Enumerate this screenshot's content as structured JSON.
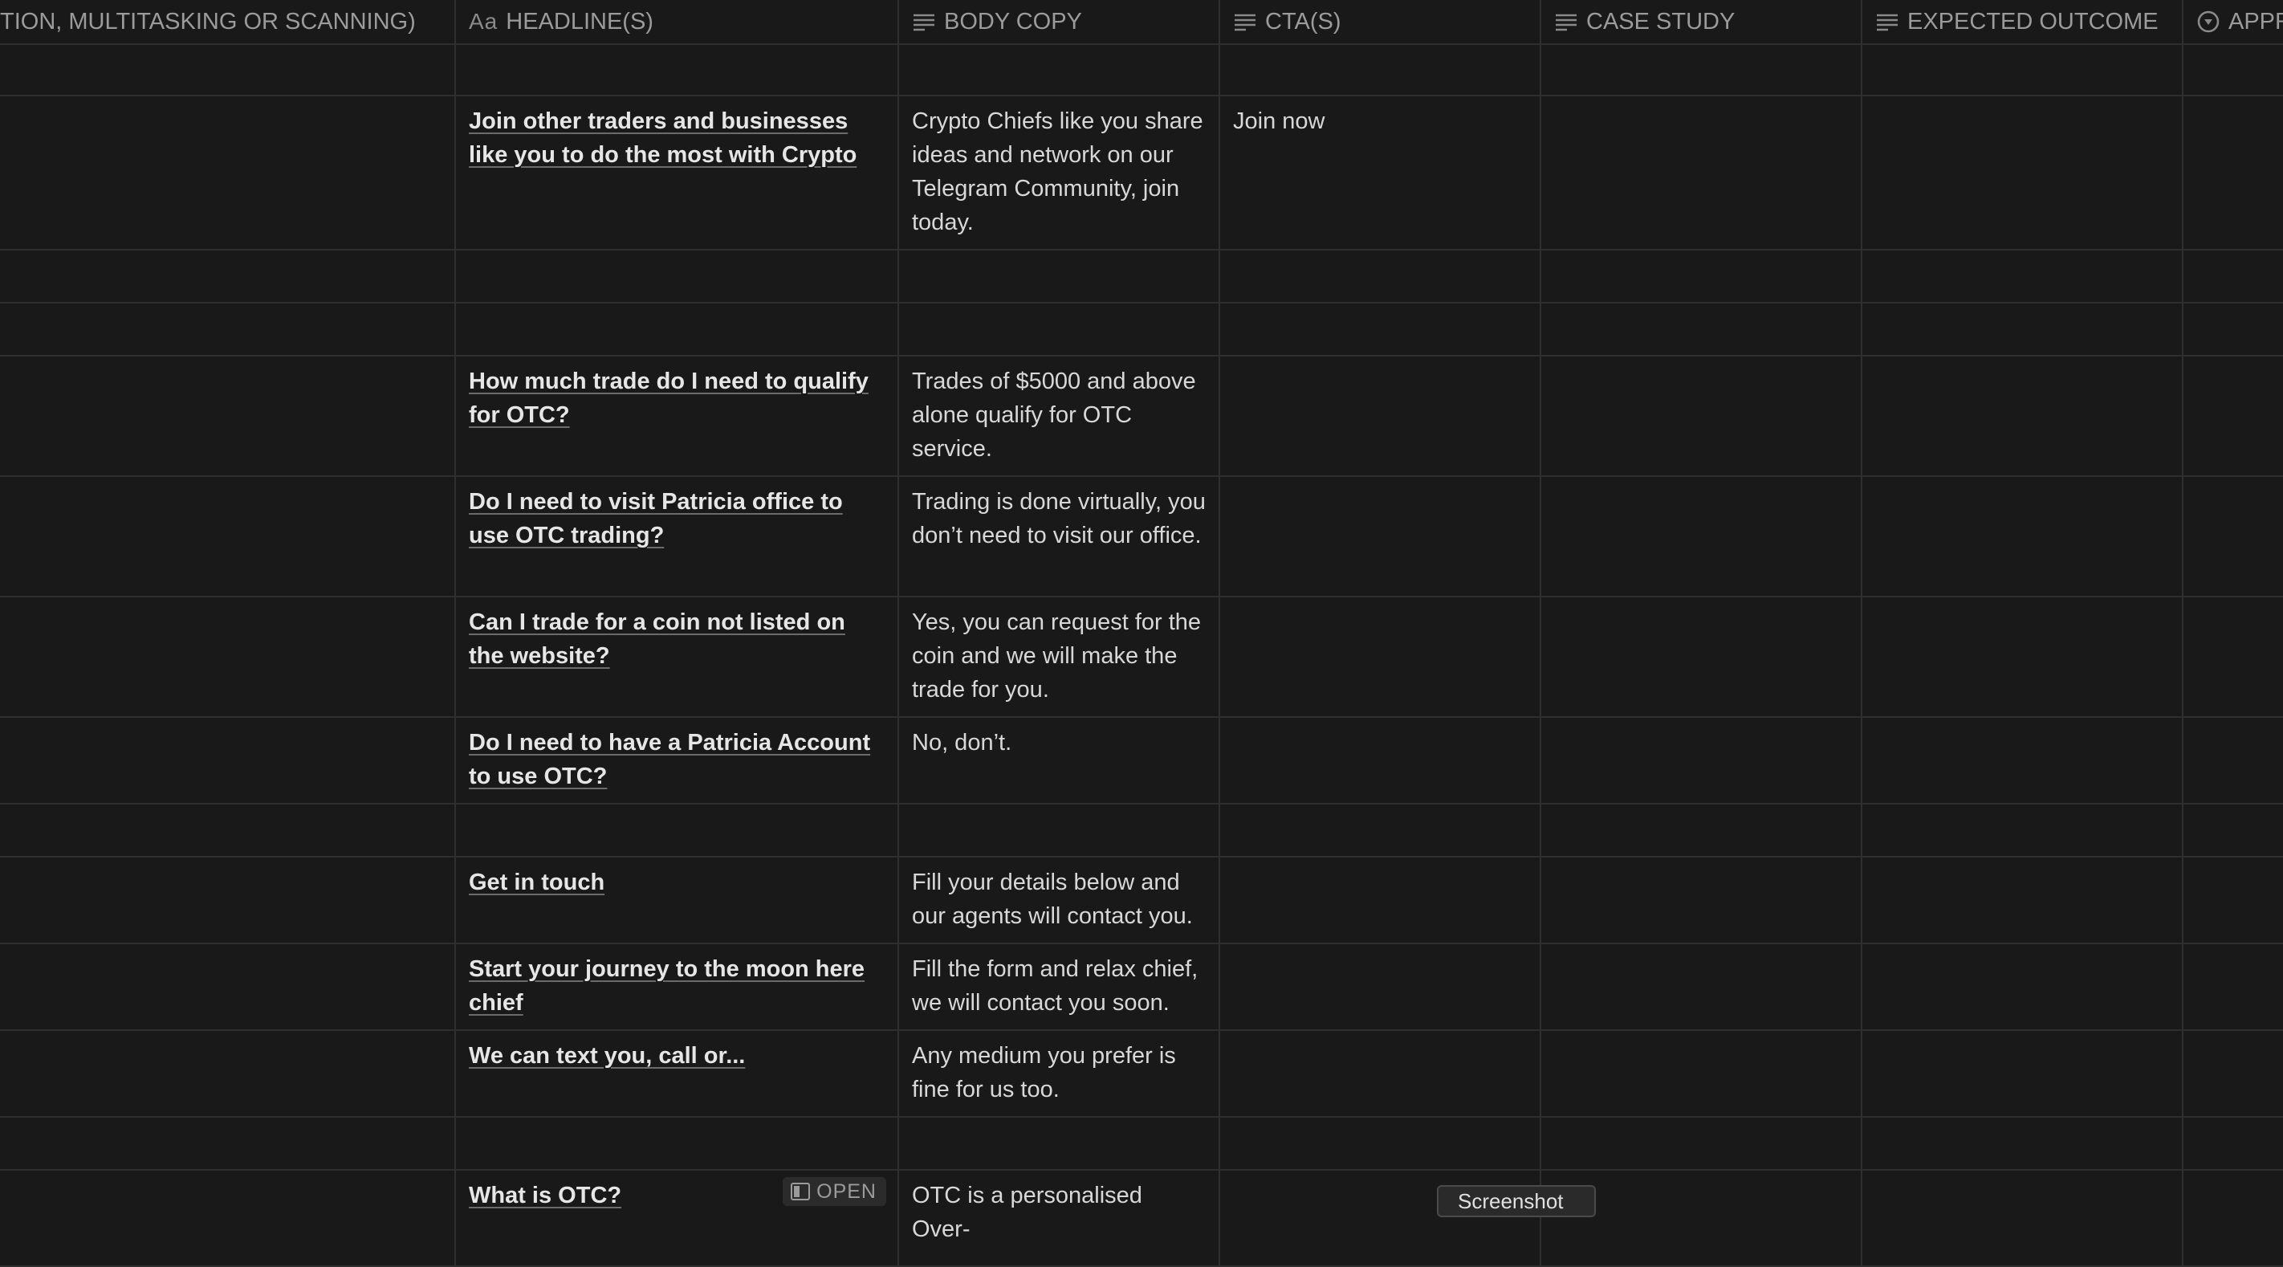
{
  "columns": {
    "c0": "TION, MULTITASKING OR SCANNING)",
    "c1": "HEADLINE(S)",
    "c1_icon": "Aa",
    "c2": "BODY COPY",
    "c3": "CTA(S)",
    "c4": "CASE STUDY",
    "c5": "EXPECTED OUTCOME",
    "c6": "APPR"
  },
  "rows": [
    {
      "headline": "",
      "body": "",
      "cta": ""
    },
    {
      "headline": "Join other traders and businesses like you to do the most with Crypto",
      "body": "Crypto Chiefs like you share ideas and network on our Telegram Community, join today.",
      "cta": "Join now"
    },
    {
      "headline": "",
      "body": "",
      "cta": ""
    },
    {
      "headline": "",
      "body": "",
      "cta": ""
    },
    {
      "headline": "How much trade do I need to qualify for OTC?",
      "body": "Trades of $5000 and above alone qualify for OTC service.",
      "cta": ""
    },
    {
      "headline": "Do I need to visit Patricia office to use OTC trading?",
      "body": "Trading is done virtually, you don’t need to visit our office.",
      "cta": ""
    },
    {
      "headline": "Can I trade for a coin not listed on the website?",
      "body": "Yes, you can request for the coin and we will make the trade for you.",
      "cta": ""
    },
    {
      "headline": "Do I need to have a Patricia Account to use OTC?",
      "body": "No, don’t.",
      "cta": ""
    },
    {
      "headline": "",
      "body": "",
      "cta": ""
    },
    {
      "headline": "Get in touch",
      "body": "Fill your details below and our agents will contact you.",
      "cta": ""
    },
    {
      "headline": "Start your journey to the moon here chief",
      "body": "Fill the form and relax chief, we will contact you soon.",
      "cta": ""
    },
    {
      "headline": "We can text you, call or...",
      "body": "Any medium you prefer is fine for us too.",
      "cta": ""
    },
    {
      "headline": "",
      "body": "",
      "cta": ""
    },
    {
      "headline": "What is OTC?",
      "body": "OTC is a personalised Over-",
      "cta": ""
    }
  ],
  "open_button": "OPEN",
  "tooltip": "Screenshot"
}
